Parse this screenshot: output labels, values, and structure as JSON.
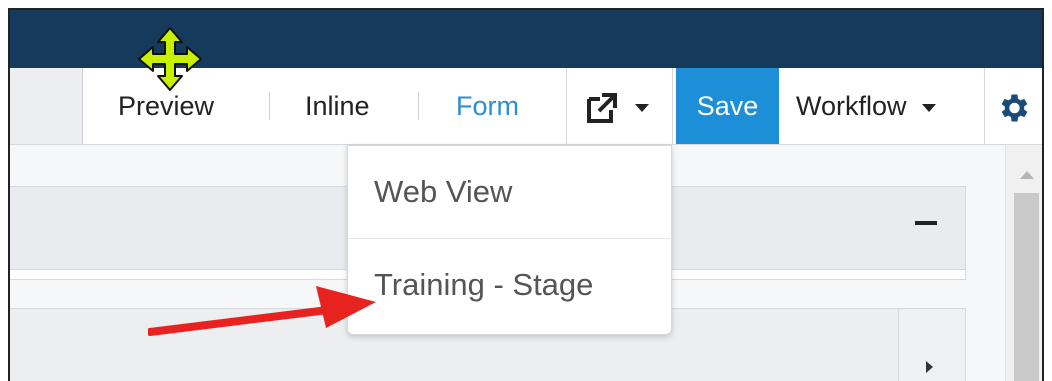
{
  "toolbar": {
    "preview_label": "Preview",
    "inline_label": "Inline",
    "form_label": "Form",
    "save_label": "Save",
    "workflow_label": "Workflow",
    "external_icon": "external-link-icon",
    "settings_icon": "gear-icon"
  },
  "dropdown": {
    "items": [
      {
        "label": "Web View"
      },
      {
        "label": "Training - Stage"
      }
    ]
  },
  "colors": {
    "topbar": "#163a5c",
    "save_button": "#1d8fd8",
    "form_link": "#2a8fd4",
    "annotation_arrow": "#e8231f",
    "move_cursor": "#c8f000"
  }
}
